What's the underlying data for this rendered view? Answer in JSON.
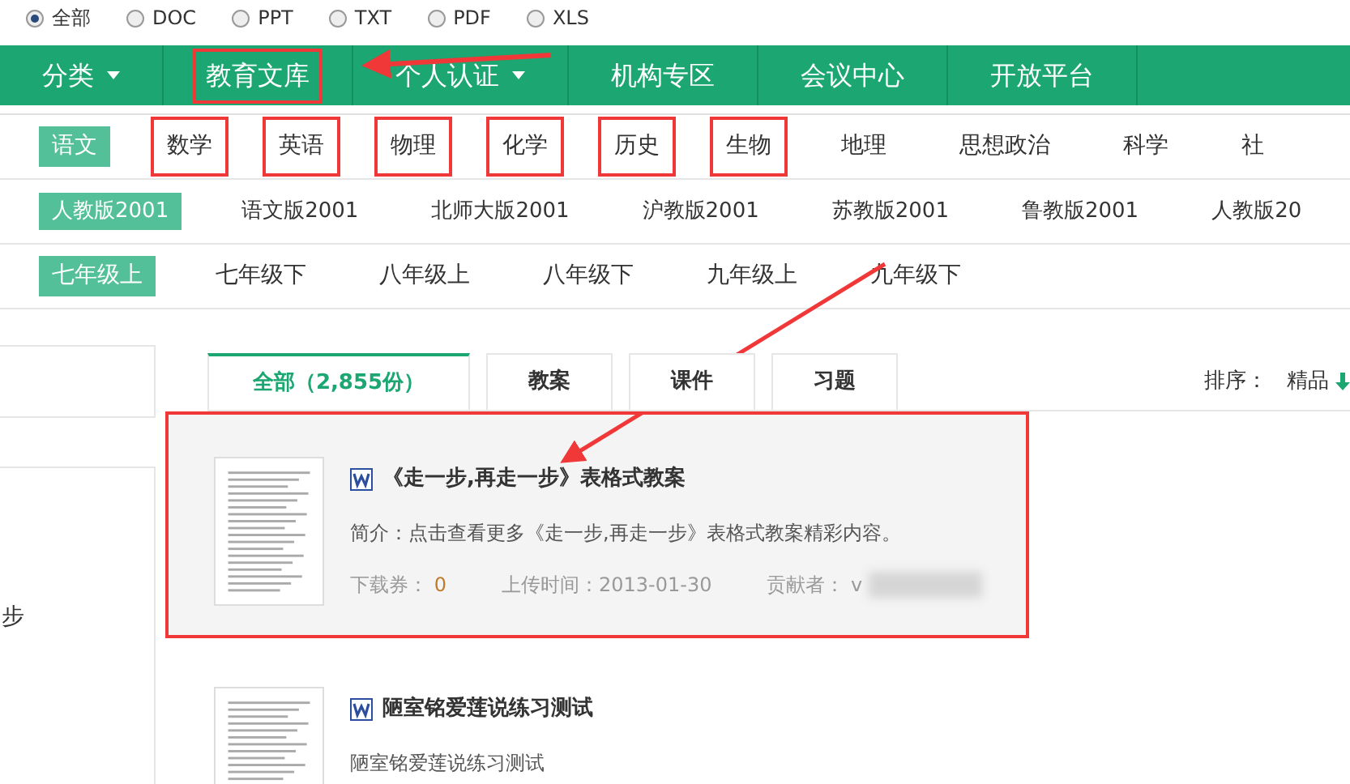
{
  "file_types": [
    {
      "label": "全部",
      "selected": true
    },
    {
      "label": "DOC",
      "selected": false
    },
    {
      "label": "PPT",
      "selected": false
    },
    {
      "label": "TXT",
      "selected": false
    },
    {
      "label": "PDF",
      "selected": false
    },
    {
      "label": "XLS",
      "selected": false
    }
  ],
  "nav": [
    {
      "label": "分类",
      "has_menu": true,
      "highlighted": false
    },
    {
      "label": "教育文库",
      "has_menu": false,
      "highlighted": true
    },
    {
      "label": "个人认证",
      "has_menu": true,
      "highlighted": false
    },
    {
      "label": "机构专区",
      "has_menu": false,
      "highlighted": false
    },
    {
      "label": "会议中心",
      "has_menu": false,
      "highlighted": false
    },
    {
      "label": "开放平台",
      "has_menu": false,
      "highlighted": false
    }
  ],
  "subjects": [
    {
      "label": "语文",
      "selected": true,
      "highlighted": false
    },
    {
      "label": "数学",
      "selected": false,
      "highlighted": true
    },
    {
      "label": "英语",
      "selected": false,
      "highlighted": true
    },
    {
      "label": "物理",
      "selected": false,
      "highlighted": true
    },
    {
      "label": "化学",
      "selected": false,
      "highlighted": true
    },
    {
      "label": "历史",
      "selected": false,
      "highlighted": true
    },
    {
      "label": "生物",
      "selected": false,
      "highlighted": true
    },
    {
      "label": "地理",
      "selected": false,
      "highlighted": false
    },
    {
      "label": "思想政治",
      "selected": false,
      "highlighted": false
    },
    {
      "label": "科学",
      "selected": false,
      "highlighted": false
    },
    {
      "label": "社",
      "selected": false,
      "highlighted": false
    }
  ],
  "versions": [
    {
      "label": "人教版2001",
      "selected": true
    },
    {
      "label": "语文版2001",
      "selected": false
    },
    {
      "label": "北师大版2001",
      "selected": false
    },
    {
      "label": "沪教版2001",
      "selected": false
    },
    {
      "label": "苏教版2001",
      "selected": false
    },
    {
      "label": "鲁教版2001",
      "selected": false
    },
    {
      "label": "人教版20",
      "selected": false
    }
  ],
  "grades": [
    {
      "label": "七年级上",
      "selected": true
    },
    {
      "label": "七年级下",
      "selected": false
    },
    {
      "label": "八年级上",
      "selected": false
    },
    {
      "label": "八年级下",
      "selected": false
    },
    {
      "label": "九年级上",
      "selected": false
    },
    {
      "label": "九年级下",
      "selected": false
    }
  ],
  "sidebar": {
    "text": "步"
  },
  "tabs": [
    {
      "label": "全部（2,855份）",
      "selected": true
    },
    {
      "label": "教案",
      "selected": false
    },
    {
      "label": "课件",
      "selected": false
    },
    {
      "label": "习题",
      "selected": false
    }
  ],
  "sort": {
    "label": "排序：",
    "option": "精品"
  },
  "documents": [
    {
      "title": "《走一步,再走一步》表格式教案",
      "summary": "简介：点击查看更多《走一步,再走一步》表格式教案精彩内容。",
      "downloads_label": "下载券：",
      "downloads": "0",
      "upload_label": "上传时间：",
      "upload_date": "2013-01-30",
      "contributor_label": "贡献者：",
      "contributor": "v",
      "highlighted": true
    },
    {
      "title": "陋室铭爱莲说练习测试",
      "summary": "陋室铭爱莲说练习测试",
      "highlighted": false
    }
  ]
}
